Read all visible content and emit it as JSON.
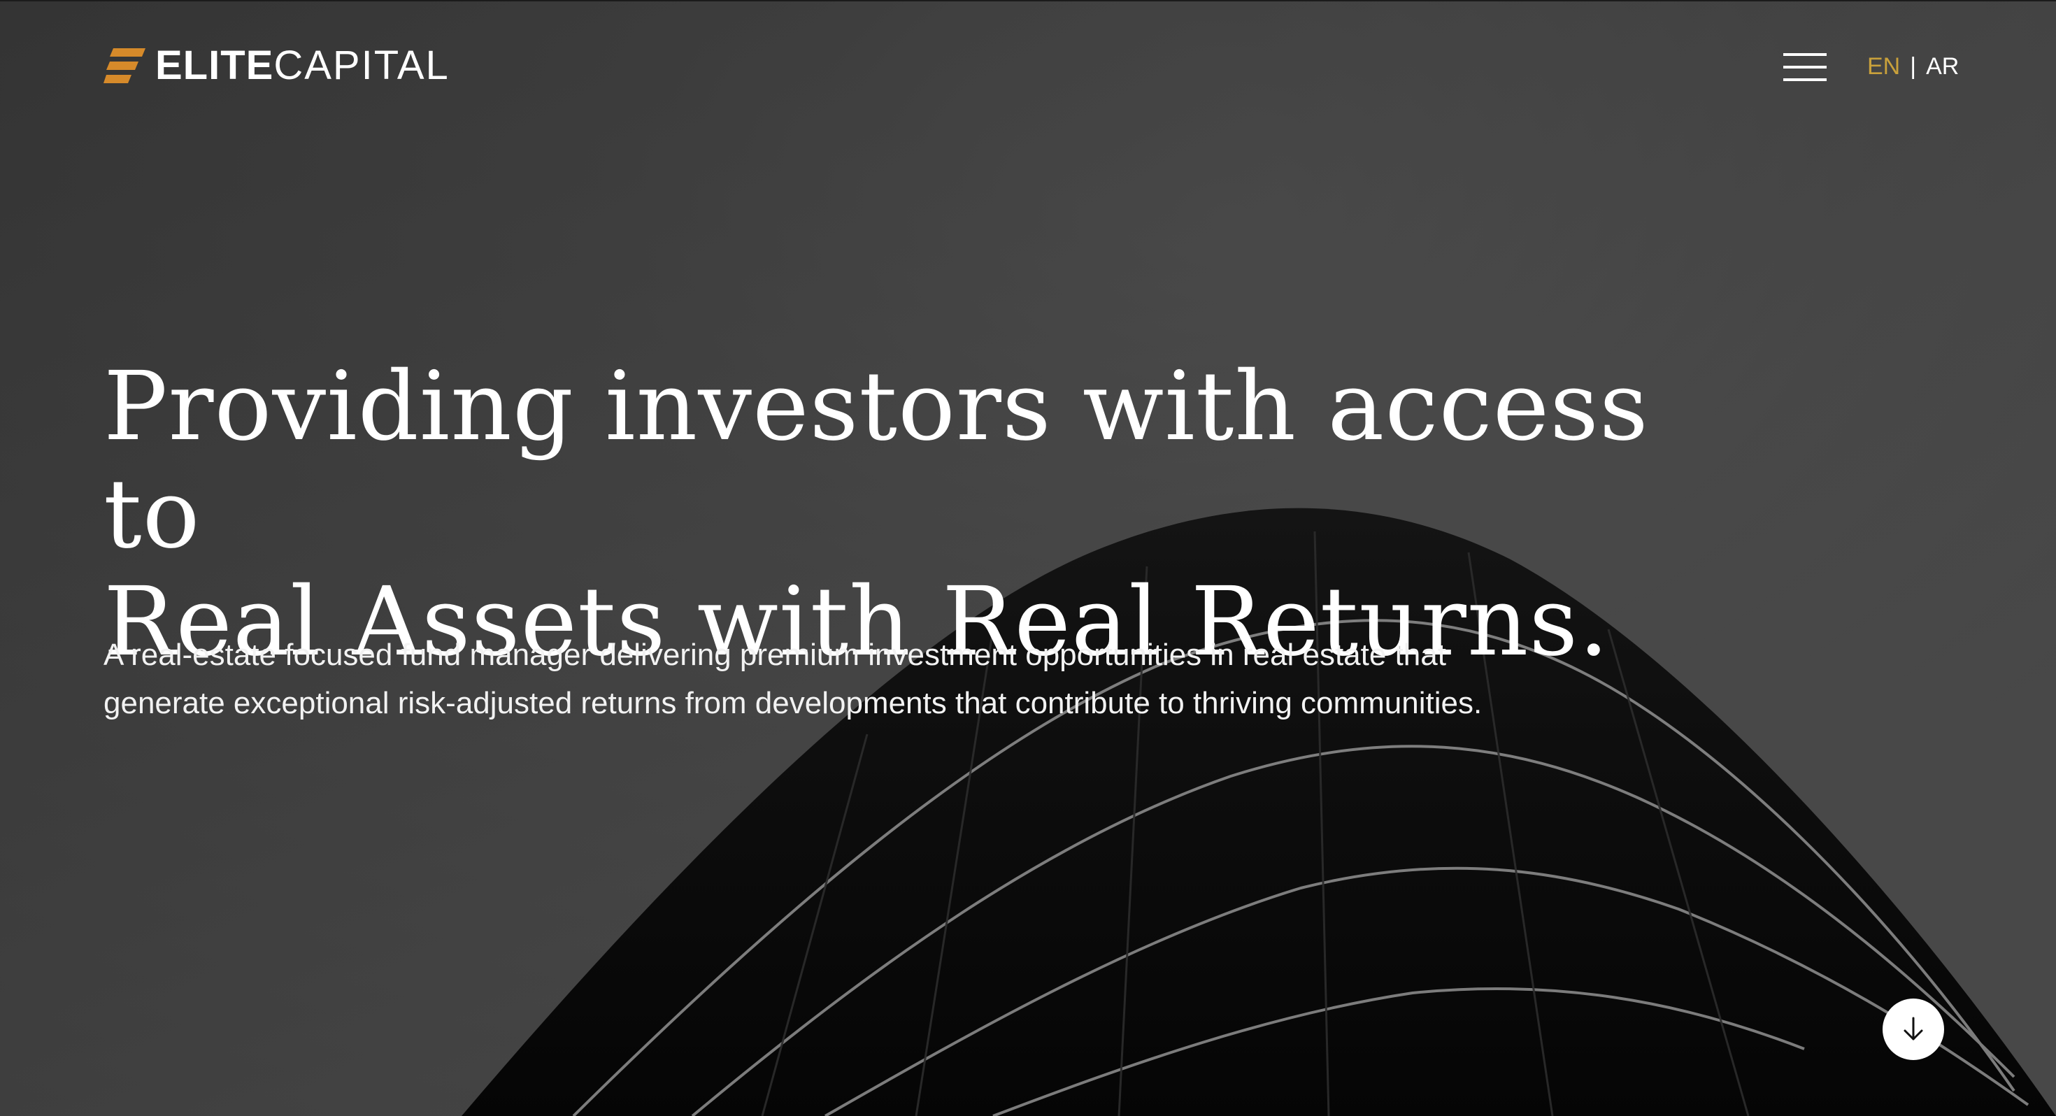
{
  "brand": {
    "name_bold": "ELITE",
    "name_light": "CAPITAL",
    "accent_color": "#d68a2a"
  },
  "header": {
    "menu_icon": "hamburger-icon",
    "lang_active": "EN",
    "lang_separator": "|",
    "lang_other": "AR",
    "lang_active_color": "#c9a13b"
  },
  "hero": {
    "headline_line1": "Providing investors with access to",
    "headline_line2": "Real Assets with Real Returns.",
    "subtext_line1": "A real-estate focused fund manager delivering premium investment opportunities in real estate that",
    "subtext_line2": "generate exceptional risk-adjusted returns from developments that contribute to thriving communities.",
    "scroll_icon": "arrow-down-icon"
  }
}
